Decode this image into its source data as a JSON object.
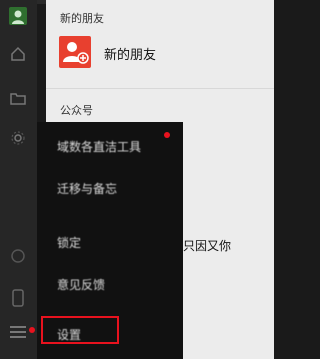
{
  "contacts": {
    "new_friends_section": "新的朋友",
    "new_friends_item": "新的朋友",
    "public_accounts_section": "公众号",
    "partial_contact_name": "只因又你"
  },
  "menu": {
    "items": [
      {
        "label": "域数各直洁工具",
        "has_badge": true
      },
      {
        "label": "迁移与备忘",
        "has_badge": false
      },
      {
        "label": "锁定",
        "has_badge": false
      },
      {
        "label": "意见反馈",
        "has_badge": false
      },
      {
        "label": "设置",
        "has_badge": false
      }
    ],
    "highlight_color": "#e8121e"
  },
  "rail": {
    "icons": [
      "avatar-icon",
      "home-icon",
      "folder-icon",
      "settings-gear-icon",
      "chat-icon",
      "phone-icon",
      "menu-icon"
    ]
  },
  "colors": {
    "accent_red": "#e8402f",
    "badge_red": "#e8121e",
    "sidebar_bg": "#262626",
    "menu_bg": "#111111",
    "content_bg": "#ececec"
  }
}
